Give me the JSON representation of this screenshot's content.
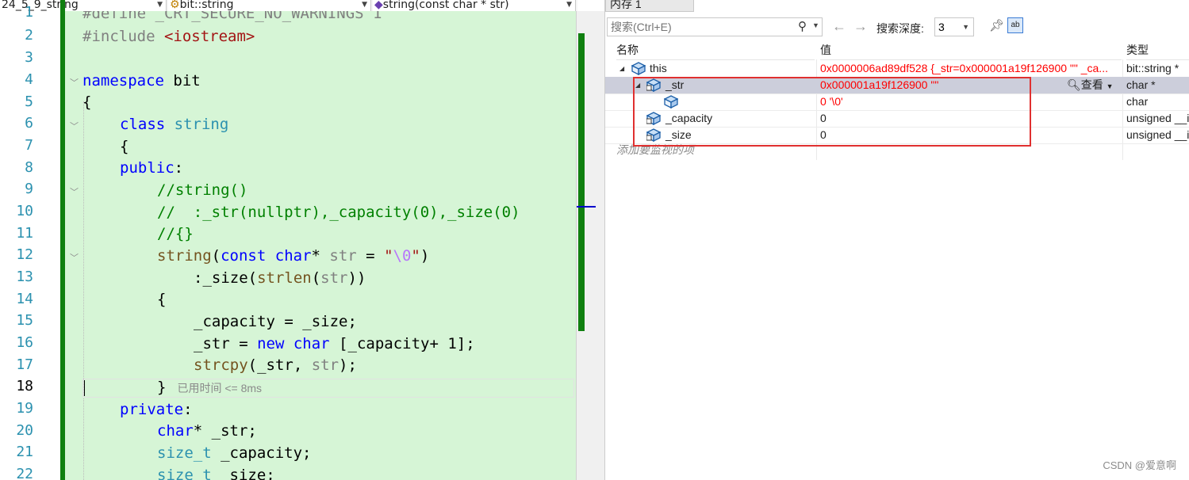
{
  "editor": {
    "nav": {
      "project": "24_5_9_string",
      "scope": "bit::string",
      "member": "string(const char * str)"
    },
    "line_numbers": [
      "1",
      "2",
      "3",
      "4",
      "5",
      "6",
      "7",
      "8",
      "9",
      "10",
      "11",
      "12",
      "13",
      "14",
      "15",
      "16",
      "17",
      "18",
      "19",
      "20",
      "21",
      "22"
    ],
    "current_line": "18",
    "lines": {
      "l1": "#define _CRT_SECURE_NO_WARNINGS 1",
      "l2a": "#include ",
      "l2b": "<iostream>",
      "l4a": "namespace",
      "l4b": " bit",
      "l5": "{",
      "l6a": "class",
      "l6b": " string",
      "l7": "{",
      "l8a": "public",
      "l8b": ":",
      "l9": "//string()",
      "l10": "//  :_str(nullptr),_capacity(0),_size(0)",
      "l11": "//{}",
      "l12a": "string",
      "l12b": "(",
      "l12c": "const",
      "l12d": " ",
      "l12e": "char",
      "l12f": "* ",
      "l12g": "str",
      "l12h": " = ",
      "l12i": "\"",
      "l12j": "\\0",
      "l12k": "\"",
      "l12l": ")",
      "l13a": ":_size(",
      "l13b": "strlen",
      "l13c": "(",
      "l13d": "str",
      "l13e": "))",
      "l14": "{",
      "l15": "_capacity = _size;",
      "l16a": "_str = ",
      "l16b": "new",
      "l16c": " ",
      "l16d": "char",
      "l16e": " [_capacity+ 1];",
      "l17a": "strcpy",
      "l17b": "(_str, ",
      "l17c": "str",
      "l17d": ");",
      "l18a": "}",
      "l18hint": "已用时间 <= 8ms",
      "l19a": "private",
      "l19b": ":",
      "l20a": "char",
      "l20b": "* _str;",
      "l21a": "size_t",
      "l21b": " _capacity;",
      "l22a": "size_t",
      "l22b": " _size;"
    }
  },
  "watch": {
    "tab_title": "内存 1",
    "search_placeholder": "搜索(Ctrl+E)",
    "depth_label": "搜索深度:",
    "depth_value": "3",
    "columns": {
      "name": "名称",
      "value": "值",
      "type": "类型"
    },
    "rows": [
      {
        "name": "this",
        "value": "0x0000006ad89df528 {_str=0x000001a19f126900 \"\" _ca...",
        "type": "bit::string *"
      },
      {
        "name": "_str",
        "value": "0x000001a19f126900 \"\"",
        "type": "char *",
        "view": "查看"
      },
      {
        "name": "",
        "value": "0 '\\0'",
        "type": "char"
      },
      {
        "name": "_capacity",
        "value": "0",
        "type": "unsigned __i"
      },
      {
        "name": "_size",
        "value": "0",
        "type": "unsigned __i"
      }
    ],
    "add_placeholder": "添加要监视的项",
    "colors": {
      "changed_value": "#ff0000",
      "selected_row": "#cccedb",
      "highlight_box": "#e03030"
    }
  },
  "watermark": "CSDN @爱意啊"
}
